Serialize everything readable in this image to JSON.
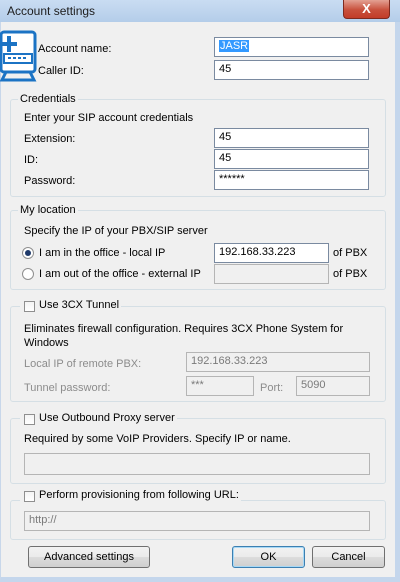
{
  "window": {
    "title": "Account settings",
    "close_glyph": "X"
  },
  "account": {
    "name_label": "Account name:",
    "name_value": "JASR",
    "caller_label": "Caller ID:",
    "caller_value": "45"
  },
  "credentials": {
    "title": "Credentials",
    "hint": "Enter your SIP account credentials",
    "extension_label": "Extension:",
    "extension_value": "45",
    "id_label": "ID:",
    "id_value": "45",
    "password_label": "Password:",
    "password_value": "******"
  },
  "location": {
    "title": "My location",
    "hint": "Specify the IP of your PBX/SIP server",
    "office_label": "I am in the office - local IP",
    "office_ip": "192.168.33.223",
    "office_suffix": "of PBX",
    "external_label": "I am out of the office - external IP",
    "external_ip": "",
    "external_suffix": "of PBX",
    "selected": "office"
  },
  "tunnel": {
    "label": "Use 3CX Tunnel",
    "checked": false,
    "description": "Eliminates firewall configuration. Requires 3CX Phone System for Windows",
    "local_ip_label": "Local IP of remote PBX:",
    "local_ip_value": "192.168.33.223",
    "password_label": "Tunnel password:",
    "password_value": "***",
    "port_label": "Port:",
    "port_value": "5090"
  },
  "proxy": {
    "label": "Use Outbound Proxy server",
    "checked": false,
    "description": "Required by some VoIP Providers. Specify IP or name.",
    "value": ""
  },
  "provisioning": {
    "label": "Perform provisioning from following URL:",
    "checked": false,
    "url_value": "http://"
  },
  "buttons": {
    "advanced": "Advanced settings",
    "ok": "OK",
    "cancel": "Cancel"
  },
  "icons": {
    "app": "3cx-phone-monitor-icon",
    "close": "close-icon"
  },
  "colors": {
    "title_bar": "#b4cde9",
    "close_button": "#c8503c",
    "selection": "#3399ff",
    "dialog_bg": "#f0f0f0"
  }
}
